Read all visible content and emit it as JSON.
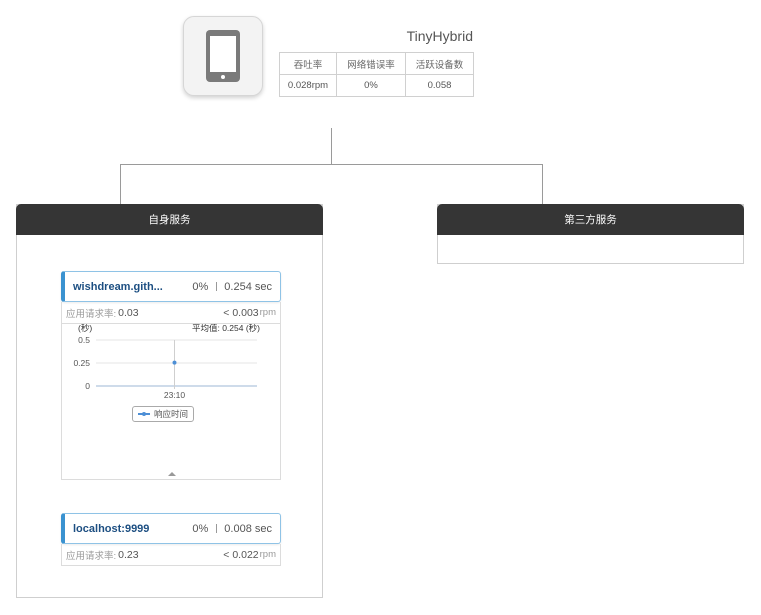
{
  "app": {
    "name": "TinyHybrid",
    "icon": "phone-icon",
    "metrics": {
      "headers": [
        "吞吐率",
        "网络错误率",
        "活跃设备数"
      ],
      "values": [
        "0.028rpm",
        "0%",
        "0.058"
      ]
    }
  },
  "groups": {
    "self": {
      "title": "自身服务"
    },
    "third": {
      "title": "第三方服务"
    }
  },
  "services": [
    {
      "name": "wishdream.gith...",
      "error_rate": "0%",
      "response": "0.254 sec",
      "sub_label": "应用请求率:",
      "sub_value": "0.03",
      "rpm_value": "< 0.003",
      "rpm_unit": "rpm"
    },
    {
      "name": "localhost:9999",
      "error_rate": "0%",
      "response": "0.008 sec",
      "sub_label": "应用请求率:",
      "sub_value": "0.23",
      "rpm_value": "< 0.022",
      "rpm_unit": "rpm"
    }
  ],
  "chart_data": {
    "type": "line",
    "ylabel": "(秒)",
    "avg_label": "平均值: 0.254 (秒)",
    "y_ticks": [
      "0.5",
      "0.25",
      "0"
    ],
    "ylim": [
      0,
      0.5
    ],
    "categories": [
      "23:10"
    ],
    "series": [
      {
        "name": "响应时间",
        "values": [
          0.254
        ]
      }
    ],
    "grid": true,
    "legend": "bottom-center"
  },
  "colors": {
    "accent": "#3a92d0",
    "header_bg": "#353535",
    "series": "#4d8fd6"
  }
}
